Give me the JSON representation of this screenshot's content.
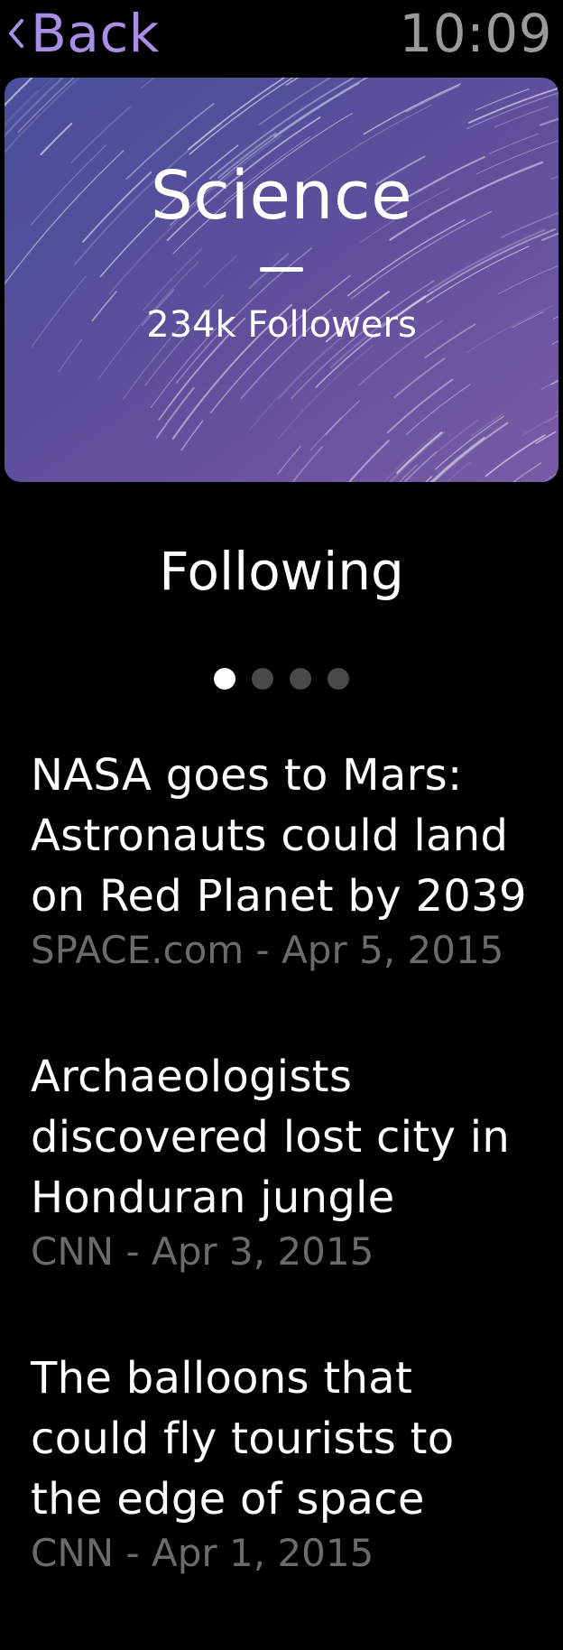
{
  "status_bar": {
    "back_label": "Back",
    "time": "10:09"
  },
  "hero": {
    "title": "Science",
    "followers": "234k Followers",
    "background_colors": [
      "#4b4f9e",
      "#6a4f9a",
      "#7a5aa8"
    ]
  },
  "follow_button": {
    "label": "Following"
  },
  "pager": {
    "total": 4,
    "active_index": 0
  },
  "articles": [
    {
      "title": "NASA goes to Mars:\nAstronauts could land\non Red Planet by 2039",
      "source": "SPACE.com",
      "date": "Apr 5, 2015",
      "meta": "SPACE.com - Apr 5, 2015"
    },
    {
      "title": "Archaeologists\ndiscovered lost city in\nHonduran jungle",
      "source": "CNN",
      "date": "Apr 3, 2015",
      "meta": "CNN - Apr 3, 2015"
    },
    {
      "title": "The balloons that\ncould fly tourists to\nthe edge of space",
      "source": "CNN",
      "date": "Apr 1, 2015",
      "meta": "CNN - Apr 1, 2015"
    }
  ],
  "colors": {
    "accent": "#a98ee6",
    "background": "#000000",
    "secondary_text": "#6b6b6b",
    "clock_text": "#9a9a9a",
    "dot_inactive": "#4a4a4a"
  }
}
